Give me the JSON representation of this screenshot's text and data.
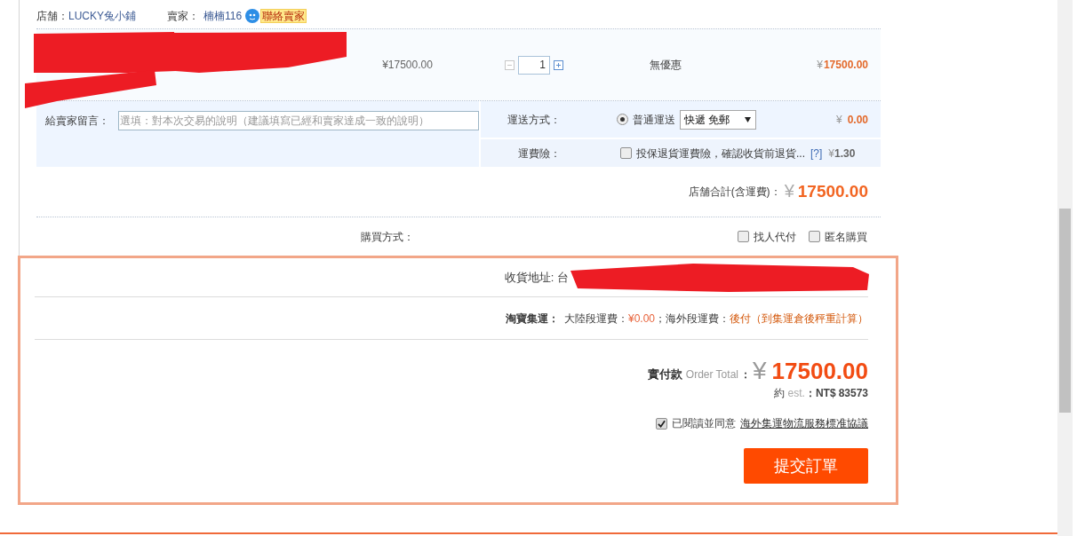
{
  "shop": {
    "label": "店舗：",
    "name": "LUCKY兔小鋪",
    "seller_label": "賣家：",
    "seller_name": "楠楠116",
    "contact": "聯絡賣家"
  },
  "item": {
    "unit_price": "¥17500.00",
    "quantity": "1",
    "decrease_disabled": true,
    "discount": "無優惠",
    "subtotal_currency": "¥",
    "subtotal": "17500.00"
  },
  "message": {
    "label": "給賣家留言：",
    "placeholder": "選填：對本次交易的說明（建議填寫已經和賣家達成一致的說明）"
  },
  "shipping": {
    "label": "運送方式：",
    "options": [
      {
        "label": "普通運送",
        "selected": true
      }
    ],
    "select_value": "快遞 免郵",
    "currency": "¥",
    "amount": "0.00"
  },
  "insurance": {
    "label": "運費險：",
    "checked": false,
    "text": "投保退貨運費險，確認收貨前退貨...",
    "help": "[?]",
    "currency": "¥",
    "amount": "1.30"
  },
  "shop_total": {
    "label": "店舗合計(含運費)：",
    "currency": "¥",
    "amount": "17500.00"
  },
  "purchase": {
    "label": "購買方式：",
    "options": [
      {
        "label": "找人代付",
        "checked": false
      },
      {
        "label": "匿名購買",
        "checked": false
      }
    ]
  },
  "address": {
    "label": "收貨地址:",
    "value": "台"
  },
  "consolidation": {
    "label": "淘寶集運：",
    "mainland_label": "大陸段運費：",
    "mainland_fee": "¥0.00",
    "overseas_label": "；海外段運費：",
    "overseas_fee": "後付（到集運倉後秤重計算）"
  },
  "order_total": {
    "label": "實付款",
    "label_en": "Order Total",
    "colon": "：",
    "currency": "¥",
    "amount": "17500.00",
    "approx": "約",
    "est": "est.",
    "nt_label": "：NT$",
    "nt_amount": "83573"
  },
  "agreement": {
    "checked": true,
    "text": "已閱讀並同意",
    "link": "海外集運物流服務標准協議"
  },
  "submit": "提交訂單"
}
